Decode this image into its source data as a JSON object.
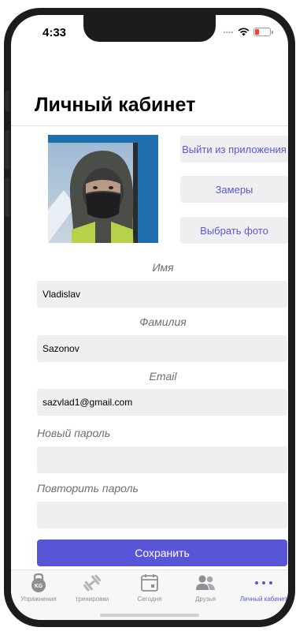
{
  "status_bar": {
    "time": "4:33"
  },
  "header": {
    "title": "Личный кабинет"
  },
  "profile": {
    "logout_label": "Выйти из приложения",
    "measurements_label": "Замеры",
    "choose_photo_label": "Выбрать фото"
  },
  "form": {
    "first_name_label": "Имя",
    "first_name_value": "Vladislav",
    "last_name_label": "Фамилия",
    "last_name_value": "Sazonov",
    "email_label": "Email",
    "email_value": "sazvlad1@gmail.com",
    "new_password_label": "Новый пароль",
    "new_password_value": "",
    "repeat_password_label": "Повторить пароль",
    "repeat_password_value": "",
    "save_label": "Сохранить"
  },
  "tabbar": {
    "items": [
      {
        "label": "Упражнения",
        "icon": "kettlebell-icon"
      },
      {
        "label": "тренировки",
        "icon": "dumbbell-icon"
      },
      {
        "label": "Сегодня",
        "icon": "calendar-icon"
      },
      {
        "label": "Друзья",
        "icon": "people-icon"
      },
      {
        "label": "Личный кабинет",
        "icon": "more-icon"
      }
    ],
    "active_index": 4,
    "kettlebell_text": "KG"
  },
  "colors": {
    "accent": "#5856d6",
    "field_background": "#efeff2",
    "inactive_tab": "#8e8e93"
  }
}
